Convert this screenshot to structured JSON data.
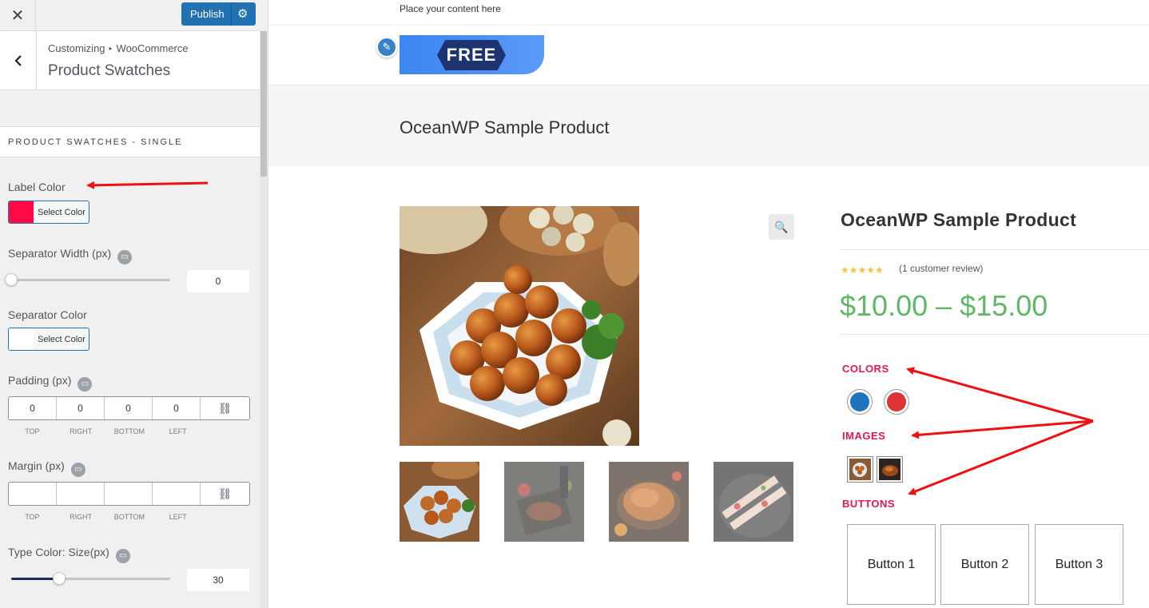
{
  "topbar": {
    "close_glyph": "✕",
    "publish_label": "Publish"
  },
  "section": {
    "breadcrumb_root": "Customizing",
    "breadcrumb_child": "WooCommerce",
    "title": "Product Swatches",
    "back_glyph": "‹"
  },
  "panel": {
    "heading": "PRODUCT SWATCHES - SINGLE",
    "label_color": {
      "label": "Label Color",
      "button_text": "Select Color",
      "value": "#ff0a46"
    },
    "separator_width": {
      "label": "Separator Width (px)",
      "value": "0",
      "slider_fraction": 0.0
    },
    "separator_color": {
      "label": "Separator Color",
      "button_text": "Select Color",
      "value": "#ffffff"
    },
    "padding": {
      "label": "Padding (px)",
      "values": [
        "0",
        "0",
        "0",
        "0"
      ],
      "sides": [
        "TOP",
        "RIGHT",
        "BOTTOM",
        "LEFT"
      ]
    },
    "margin": {
      "label": "Margin (px)",
      "values": [
        "",
        "",
        "",
        ""
      ],
      "sides": [
        "TOP",
        "RIGHT",
        "BOTTOM",
        "LEFT"
      ]
    },
    "type_color_size": {
      "label": "Type Color: Size(px)",
      "value": "30",
      "slider_fraction": 0.3
    },
    "icons": {
      "info": "monitor-icon",
      "link": "unlink-icon"
    }
  },
  "preview": {
    "top_text": "Place your content here",
    "banner_text": "FREE",
    "page_title": "OceanWP Sample Product",
    "product_title": "OceanWP Sample Product",
    "rating": 5,
    "stars": "★★★★★",
    "review_text": "(1 customer review)",
    "price": "$10.00 – $15.00",
    "attributes": {
      "colors_label": "COLORS",
      "colors": [
        "#1e73be",
        "#dd3333"
      ],
      "images_label": "IMAGES",
      "buttons_label": "BUTTONS",
      "buttons": [
        "Button 1",
        "Button 2",
        "Button 3"
      ]
    },
    "accent": "#e2184a",
    "price_color": "#5fb868",
    "star_color": "#f7c146"
  }
}
